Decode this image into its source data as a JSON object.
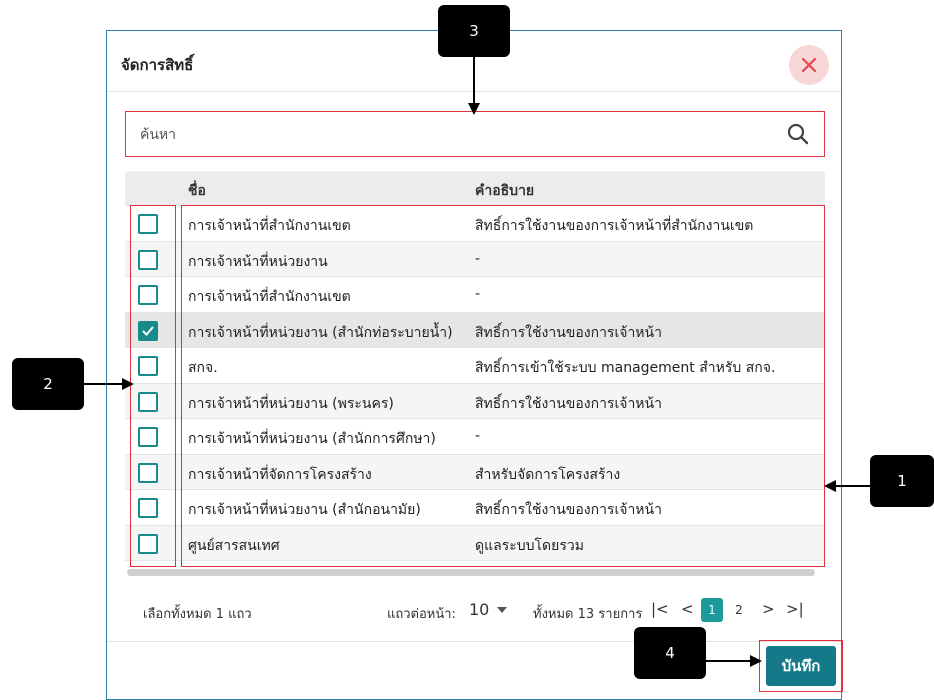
{
  "dialog": {
    "title": "จัดการสิทธิ์",
    "search_placeholder": "ค้นหา"
  },
  "table": {
    "headers": {
      "name": "ชื่อ",
      "description": "คำอธิบาย"
    },
    "rows": [
      {
        "name": "การเจ้าหน้าที่สำนักงานเขต",
        "description": "สิทธิ์การใช้งานของการเจ้าหน้าที่สำนักงานเขต",
        "checked": false
      },
      {
        "name": "การเจ้าหน้าที่หน่วยงาน",
        "description": "-",
        "checked": false
      },
      {
        "name": "การเจ้าหน้าที่สำนักงานเขต",
        "description": "-",
        "checked": false
      },
      {
        "name": "การเจ้าหน้าที่หน่วยงาน (สำนักท่อระบายน้ำ)",
        "description": "สิทธิ์การใช้งานของการเจ้าหน้า",
        "checked": true
      },
      {
        "name": "สกจ.",
        "description": "สิทธิ์การเข้าใช้ระบบ management สำหรับ สกจ.",
        "checked": false
      },
      {
        "name": "การเจ้าหน้าที่หน่วยงาน (พระนคร)",
        "description": "สิทธิ์การใช้งานของการเจ้าหน้า",
        "checked": false
      },
      {
        "name": "การเจ้าหน้าที่หน่วยงาน (สำนักการศึกษา)",
        "description": "-",
        "checked": false
      },
      {
        "name": "การเจ้าหน้าที่จัดการโครงสร้าง",
        "description": "สำหรับจัดการโครงสร้าง",
        "checked": false
      },
      {
        "name": "การเจ้าหน้าที่หน่วยงาน (สำนักอนามัย)",
        "description": "สิทธิ์การใช้งานของการเจ้าหน้า",
        "checked": false
      },
      {
        "name": "ศูนย์สารสนเทศ",
        "description": "ดูแลระบบโดยรวม",
        "checked": false
      }
    ]
  },
  "pager": {
    "selected_text": "เลือกทั้งหมด 1 แถว",
    "rows_per_page_label": "แถวต่อหน้า:",
    "rows_per_page_value": "10",
    "total_text": "ทั้งหมด 13 รายการ",
    "first": "|<",
    "prev": "<",
    "pages": [
      "1",
      "2"
    ],
    "next": ">",
    "last": ">|"
  },
  "footer": {
    "save_label": "บันทึก"
  },
  "callouts": {
    "c1": "1",
    "c2": "2",
    "c3": "3",
    "c4": "4"
  },
  "colors": {
    "accent": "#178a8a",
    "save": "#147a8a",
    "highlight": "#e0303a",
    "close_bg": "#f8d7d9"
  },
  "icons": {
    "close": "close-icon",
    "search": "search-icon",
    "check": "check-icon"
  }
}
